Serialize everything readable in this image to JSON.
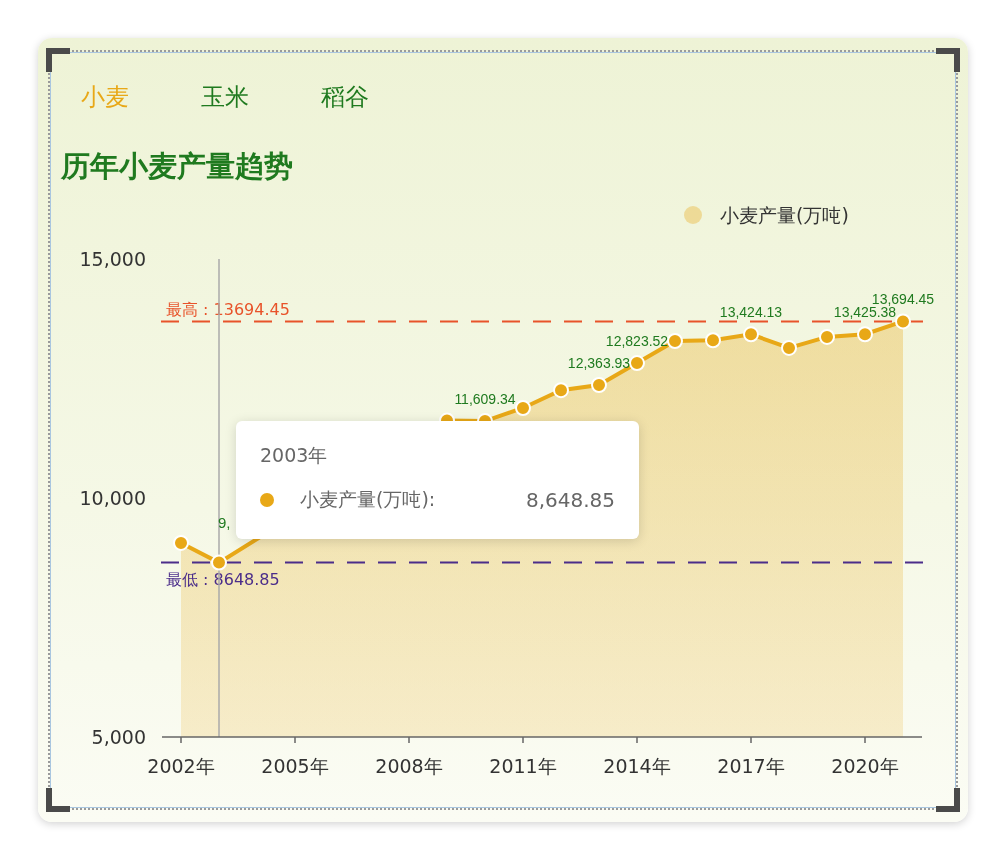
{
  "tabs": [
    {
      "label": "小麦",
      "selected": true
    },
    {
      "label": "玉米",
      "selected": false
    },
    {
      "label": "稻谷",
      "selected": false
    }
  ],
  "title": "历年小麦产量趋势",
  "chart": {
    "chart_data": {
      "type": "area",
      "x": [
        2002,
        2003,
        2009,
        2010,
        2011,
        2012,
        2013,
        2014,
        2015,
        2016,
        2017,
        2018,
        2019,
        2020,
        2021
      ],
      "series": [
        {
          "name": "小麦产量(万吨)",
          "color": "#e8a817",
          "values": [
            9060,
            8648.85,
            11620,
            11609.34,
            11883,
            12256,
            12363.93,
            12823.52,
            13285,
            13300,
            13424.13,
            13140,
            13370,
            13425.38,
            13694.45
          ],
          "value_labels": [
            null,
            null,
            null,
            "11,609.34",
            null,
            null,
            "12,363.93",
            "12,823.52",
            null,
            null,
            "13,424.13",
            null,
            null,
            "13,425.38",
            "13,694.45"
          ]
        }
      ],
      "xlim": [
        2001.5,
        2021.5
      ],
      "ylim": [
        5000,
        15000
      ],
      "xticks": [
        {
          "value": 2002,
          "label": "2002年"
        },
        {
          "value": 2005,
          "label": "2005年"
        },
        {
          "value": 2008,
          "label": "2008年"
        },
        {
          "value": 2011,
          "label": "2011年"
        },
        {
          "value": 2014,
          "label": "2014年"
        },
        {
          "value": 2017,
          "label": "2017年"
        },
        {
          "value": 2020,
          "label": "2020年"
        }
      ],
      "yticks": [
        {
          "value": 5000,
          "label": "5,000"
        },
        {
          "value": 10000,
          "label": "10,000"
        },
        {
          "value": 15000,
          "label": "15,000"
        }
      ],
      "ref_lines": [
        {
          "axis": "y",
          "value": 13694.45,
          "label": "最高 : 13694.45",
          "color": "#e8532a"
        },
        {
          "axis": "y",
          "value": 8648.85,
          "label": "最低 : 8648.85",
          "color": "#4b2d8a"
        },
        {
          "axis": "x",
          "value": 2003,
          "color": "#aaaaaa"
        }
      ]
    },
    "covered_label": "9,",
    "tooltip": {
      "title": "2003年",
      "series": "小麦产量(万吨):",
      "value": "8,648.85"
    }
  }
}
